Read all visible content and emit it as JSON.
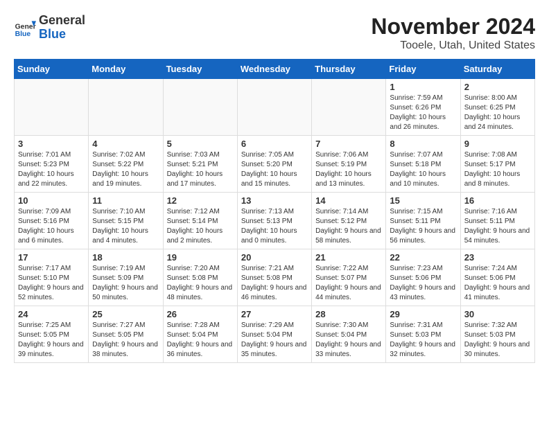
{
  "header": {
    "logo_line1": "General",
    "logo_line2": "Blue",
    "month": "November 2024",
    "location": "Tooele, Utah, United States"
  },
  "weekdays": [
    "Sunday",
    "Monday",
    "Tuesday",
    "Wednesday",
    "Thursday",
    "Friday",
    "Saturday"
  ],
  "weeks": [
    [
      {
        "day": "",
        "info": ""
      },
      {
        "day": "",
        "info": ""
      },
      {
        "day": "",
        "info": ""
      },
      {
        "day": "",
        "info": ""
      },
      {
        "day": "",
        "info": ""
      },
      {
        "day": "1",
        "info": "Sunrise: 7:59 AM\nSunset: 6:26 PM\nDaylight: 10 hours and 26 minutes."
      },
      {
        "day": "2",
        "info": "Sunrise: 8:00 AM\nSunset: 6:25 PM\nDaylight: 10 hours and 24 minutes."
      }
    ],
    [
      {
        "day": "3",
        "info": "Sunrise: 7:01 AM\nSunset: 5:23 PM\nDaylight: 10 hours and 22 minutes."
      },
      {
        "day": "4",
        "info": "Sunrise: 7:02 AM\nSunset: 5:22 PM\nDaylight: 10 hours and 19 minutes."
      },
      {
        "day": "5",
        "info": "Sunrise: 7:03 AM\nSunset: 5:21 PM\nDaylight: 10 hours and 17 minutes."
      },
      {
        "day": "6",
        "info": "Sunrise: 7:05 AM\nSunset: 5:20 PM\nDaylight: 10 hours and 15 minutes."
      },
      {
        "day": "7",
        "info": "Sunrise: 7:06 AM\nSunset: 5:19 PM\nDaylight: 10 hours and 13 minutes."
      },
      {
        "day": "8",
        "info": "Sunrise: 7:07 AM\nSunset: 5:18 PM\nDaylight: 10 hours and 10 minutes."
      },
      {
        "day": "9",
        "info": "Sunrise: 7:08 AM\nSunset: 5:17 PM\nDaylight: 10 hours and 8 minutes."
      }
    ],
    [
      {
        "day": "10",
        "info": "Sunrise: 7:09 AM\nSunset: 5:16 PM\nDaylight: 10 hours and 6 minutes."
      },
      {
        "day": "11",
        "info": "Sunrise: 7:10 AM\nSunset: 5:15 PM\nDaylight: 10 hours and 4 minutes."
      },
      {
        "day": "12",
        "info": "Sunrise: 7:12 AM\nSunset: 5:14 PM\nDaylight: 10 hours and 2 minutes."
      },
      {
        "day": "13",
        "info": "Sunrise: 7:13 AM\nSunset: 5:13 PM\nDaylight: 10 hours and 0 minutes."
      },
      {
        "day": "14",
        "info": "Sunrise: 7:14 AM\nSunset: 5:12 PM\nDaylight: 9 hours and 58 minutes."
      },
      {
        "day": "15",
        "info": "Sunrise: 7:15 AM\nSunset: 5:11 PM\nDaylight: 9 hours and 56 minutes."
      },
      {
        "day": "16",
        "info": "Sunrise: 7:16 AM\nSunset: 5:11 PM\nDaylight: 9 hours and 54 minutes."
      }
    ],
    [
      {
        "day": "17",
        "info": "Sunrise: 7:17 AM\nSunset: 5:10 PM\nDaylight: 9 hours and 52 minutes."
      },
      {
        "day": "18",
        "info": "Sunrise: 7:19 AM\nSunset: 5:09 PM\nDaylight: 9 hours and 50 minutes."
      },
      {
        "day": "19",
        "info": "Sunrise: 7:20 AM\nSunset: 5:08 PM\nDaylight: 9 hours and 48 minutes."
      },
      {
        "day": "20",
        "info": "Sunrise: 7:21 AM\nSunset: 5:08 PM\nDaylight: 9 hours and 46 minutes."
      },
      {
        "day": "21",
        "info": "Sunrise: 7:22 AM\nSunset: 5:07 PM\nDaylight: 9 hours and 44 minutes."
      },
      {
        "day": "22",
        "info": "Sunrise: 7:23 AM\nSunset: 5:06 PM\nDaylight: 9 hours and 43 minutes."
      },
      {
        "day": "23",
        "info": "Sunrise: 7:24 AM\nSunset: 5:06 PM\nDaylight: 9 hours and 41 minutes."
      }
    ],
    [
      {
        "day": "24",
        "info": "Sunrise: 7:25 AM\nSunset: 5:05 PM\nDaylight: 9 hours and 39 minutes."
      },
      {
        "day": "25",
        "info": "Sunrise: 7:27 AM\nSunset: 5:05 PM\nDaylight: 9 hours and 38 minutes."
      },
      {
        "day": "26",
        "info": "Sunrise: 7:28 AM\nSunset: 5:04 PM\nDaylight: 9 hours and 36 minutes."
      },
      {
        "day": "27",
        "info": "Sunrise: 7:29 AM\nSunset: 5:04 PM\nDaylight: 9 hours and 35 minutes."
      },
      {
        "day": "28",
        "info": "Sunrise: 7:30 AM\nSunset: 5:04 PM\nDaylight: 9 hours and 33 minutes."
      },
      {
        "day": "29",
        "info": "Sunrise: 7:31 AM\nSunset: 5:03 PM\nDaylight: 9 hours and 32 minutes."
      },
      {
        "day": "30",
        "info": "Sunrise: 7:32 AM\nSunset: 5:03 PM\nDaylight: 9 hours and 30 minutes."
      }
    ]
  ]
}
